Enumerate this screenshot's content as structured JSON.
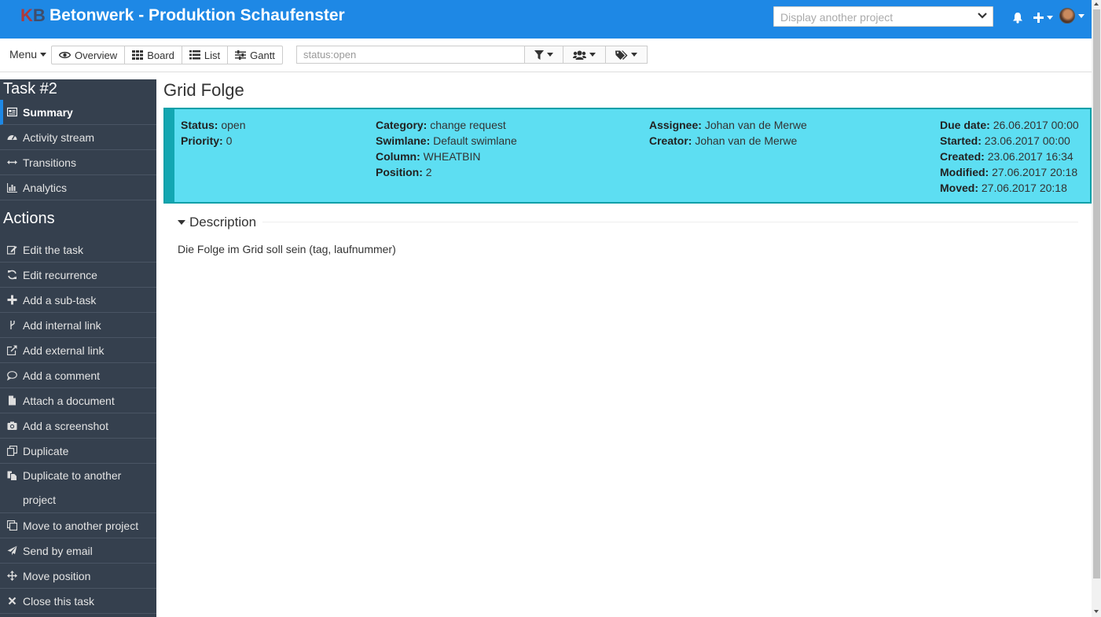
{
  "header": {
    "logo_k": "K",
    "logo_b": "B",
    "title": "Betonwerk - Produktion Schaufenster",
    "project_select_placeholder": "Display another project"
  },
  "toolbar": {
    "menu_label": "Menu",
    "views": [
      {
        "label": "Overview",
        "icon": "eye-icon"
      },
      {
        "label": "Board",
        "icon": "grid-icon"
      },
      {
        "label": "List",
        "icon": "list-icon"
      },
      {
        "label": "Gantt",
        "icon": "sliders-icon"
      }
    ],
    "search_placeholder": "status:open"
  },
  "sidebar": {
    "task_heading": "Task #2",
    "task_items": [
      {
        "label": "Summary",
        "icon": "summary-icon",
        "active": true
      },
      {
        "label": "Activity stream",
        "icon": "dashboard-icon"
      },
      {
        "label": "Transitions",
        "icon": "arrows-h-icon"
      },
      {
        "label": "Analytics",
        "icon": "bar-chart-icon"
      }
    ],
    "actions_heading": "Actions",
    "actions": [
      {
        "label": "Edit the task",
        "icon": "edit-icon"
      },
      {
        "label": "Edit recurrence",
        "icon": "refresh-icon"
      },
      {
        "label": "Add a sub-task",
        "icon": "plus-icon"
      },
      {
        "label": "Add internal link",
        "icon": "code-fork-icon"
      },
      {
        "label": "Add external link",
        "icon": "external-link-icon"
      },
      {
        "label": "Add a comment",
        "icon": "comment-icon"
      },
      {
        "label": "Attach a document",
        "icon": "file-icon"
      },
      {
        "label": "Add a screenshot",
        "icon": "camera-icon"
      },
      {
        "label": "Duplicate",
        "icon": "duplicate-icon"
      },
      {
        "label": "Duplicate to another project",
        "icon": "files-icon"
      },
      {
        "label": "Move to another project",
        "icon": "clone-icon"
      },
      {
        "label": "Send by email",
        "icon": "paper-plane-icon"
      },
      {
        "label": "Move position",
        "icon": "arrows-icon"
      },
      {
        "label": "Close this task",
        "icon": "times-icon"
      }
    ]
  },
  "task": {
    "title": "Grid Folge",
    "color": "#5ddef2",
    "border_color": "#10a0a8",
    "status_label": "Status:",
    "status_value": "open",
    "priority_label": "Priority:",
    "priority_value": "0",
    "category_label": "Category:",
    "category_value": "change request",
    "swimlane_label": "Swimlane:",
    "swimlane_value": "Default swimlane",
    "column_label": "Column:",
    "column_value": "WHEATBIN",
    "position_label": "Position:",
    "position_value": "2",
    "assignee_label": "Assignee:",
    "assignee_value": "Johan van de Merwe",
    "creator_label": "Creator:",
    "creator_value": "Johan van de Merwe",
    "due_label": "Due date:",
    "due_value": "26.06.2017 00:00",
    "started_label": "Started:",
    "started_value": "23.06.2017 00:00",
    "created_label": "Created:",
    "created_value": "23.06.2017 16:34",
    "modified_label": "Modified:",
    "modified_value": "27.06.2017 20:18",
    "moved_label": "Moved:",
    "moved_value": "27.06.2017 20:18"
  },
  "description": {
    "heading": "Description",
    "text": "Die Folge im Grid soll sein (tag, laufnummer)"
  }
}
